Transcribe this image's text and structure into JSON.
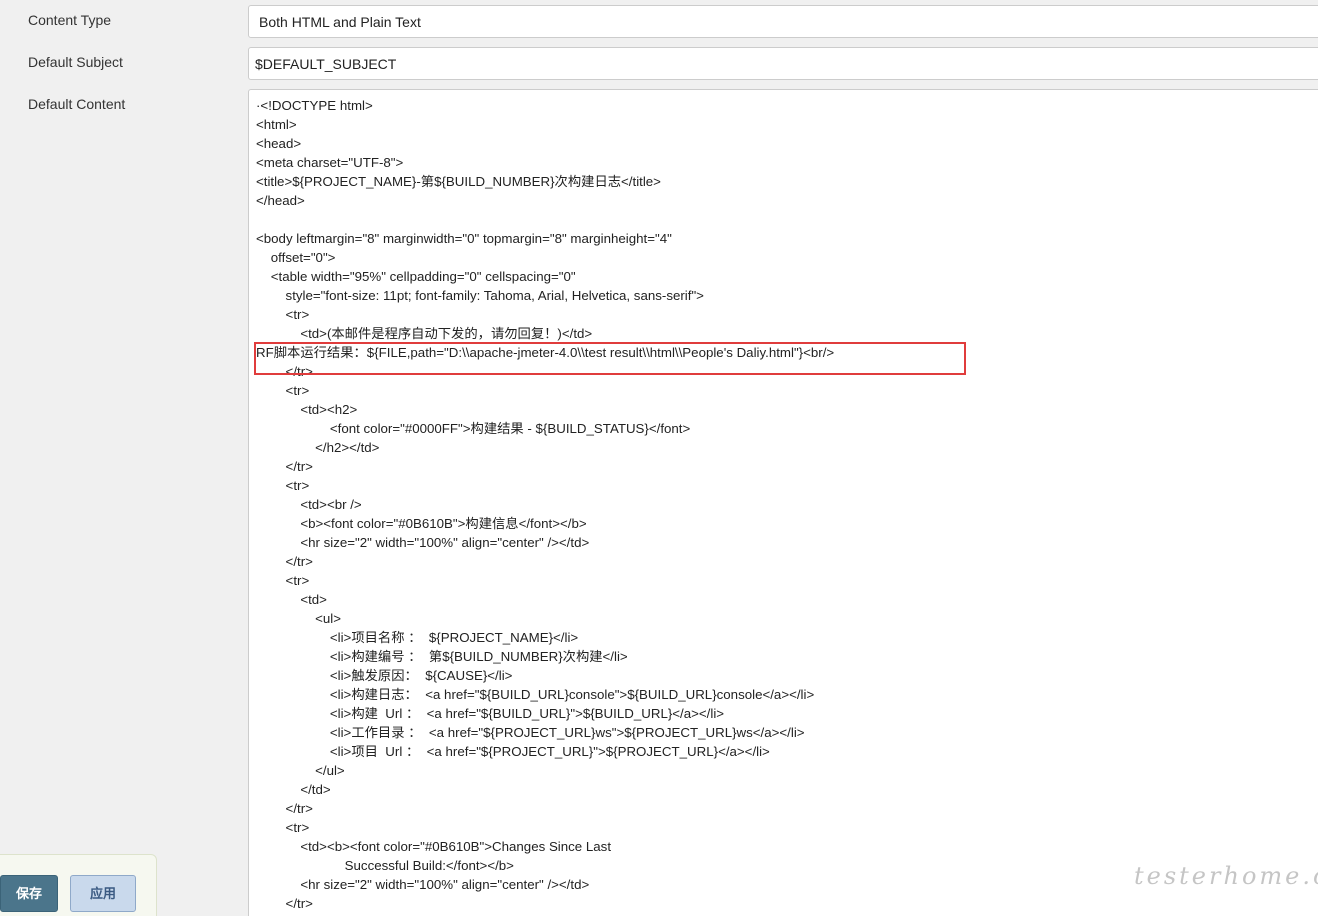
{
  "form": {
    "content_type": {
      "label": "Content Type",
      "value": "Both HTML and Plain Text"
    },
    "default_subject": {
      "label": "Default Subject",
      "value": "$DEFAULT_SUBJECT"
    },
    "default_content": {
      "label": "Default Content",
      "lines": [
        "·<!DOCTYPE html>",
        "<html>",
        "<head>",
        "<meta charset=\"UTF-8\">",
        "<title>${PROJECT_NAME}-第${BUILD_NUMBER}次构建日志</title>",
        "</head>",
        "",
        "<body leftmargin=\"8\" marginwidth=\"0\" topmargin=\"8\" marginheight=\"4\"",
        "    offset=\"0\">",
        "    <table width=\"95%\" cellpadding=\"0\" cellspacing=\"0\"",
        "        style=\"font-size: 11pt; font-family: Tahoma, Arial, Helvetica, sans-serif\">",
        "        <tr>",
        "            <td>(本邮件是程序自动下发的，请勿回复！)</td>",
        "RF脚本运行结果：${FILE,path=\"D:\\\\apache-jmeter-4.0\\\\test result\\\\html\\\\People's Daliy.html\"}<br/>",
        "        </tr>",
        "        <tr>",
        "            <td><h2>",
        "                    <font color=\"#0000FF\">构建结果 - ${BUILD_STATUS}</font>",
        "                </h2></td>",
        "        </tr>",
        "        <tr>",
        "            <td><br />",
        "            <b><font color=\"#0B610B\">构建信息</font></b>",
        "            <hr size=\"2\" width=\"100%\" align=\"center\" /></td>",
        "        </tr>",
        "        <tr>",
        "            <td>",
        "                <ul>",
        "                    <li>项目名称 ：  ${PROJECT_NAME}</li>",
        "                    <li>构建编号 ：  第${BUILD_NUMBER}次构建</li>",
        "                    <li>触发原因：  ${CAUSE}</li>",
        "                    <li>构建日志：  <a href=\"${BUILD_URL}console\">${BUILD_URL}console</a></li>",
        "                    <li>构建  Url ：  <a href=\"${BUILD_URL}\">${BUILD_URL}</a></li>",
        "                    <li>工作目录 ：  <a href=\"${PROJECT_URL}ws\">${PROJECT_URL}ws</a></li>",
        "                    <li>项目  Url ：  <a href=\"${PROJECT_URL}\">${PROJECT_URL}</a></li>",
        "                </ul>",
        "            </td>",
        "        </tr>",
        "        <tr>",
        "            <td><b><font color=\"#0B610B\">Changes Since Last",
        "                        Successful Build:</font></b>",
        "            <hr size=\"2\" width=\"100%\" align=\"center\" /></td>",
        "        </tr>"
      ]
    }
  },
  "buttons": {
    "save_label": "保存",
    "apply_label": "应用"
  },
  "watermark": "testerhome.com",
  "colors": {
    "highlight_border": "#e03c3c",
    "save_button": "#4b758b",
    "apply_button": "#c9d9ec"
  }
}
